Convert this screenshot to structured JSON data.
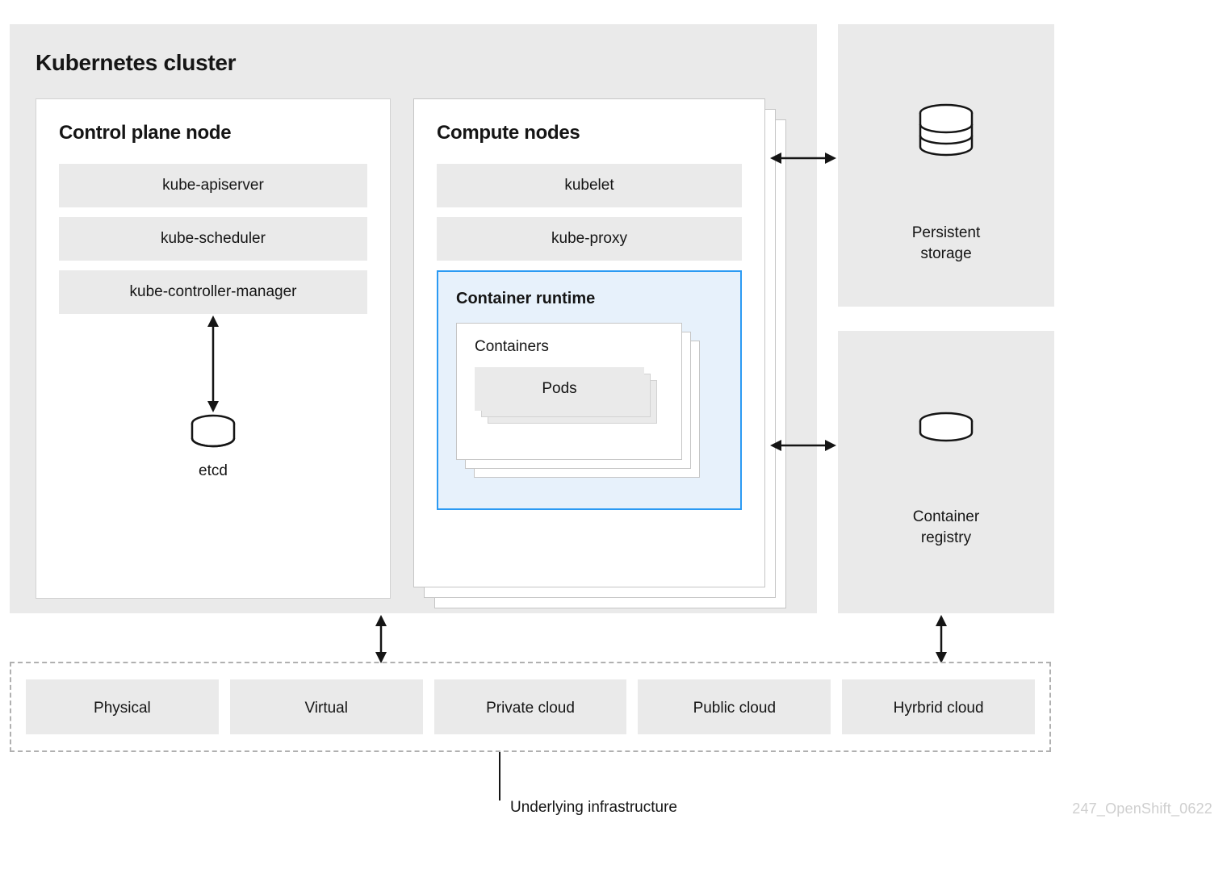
{
  "cluster": {
    "title": "Kubernetes cluster",
    "control_plane": {
      "title": "Control plane node",
      "items": [
        "kube-apiserver",
        "kube-scheduler",
        "kube-controller-manager"
      ],
      "store": "etcd"
    },
    "compute": {
      "title": "Compute nodes",
      "items": [
        "kubelet",
        "kube-proxy"
      ],
      "runtime": {
        "title": "Container runtime",
        "containers_title": "Containers",
        "pods_label": "Pods"
      }
    }
  },
  "side": {
    "storage": "Persistent\nstorage",
    "registry": "Container\nregistry"
  },
  "infra": {
    "items": [
      "Physical",
      "Virtual",
      "Private cloud",
      "Public cloud",
      "Hyrbrid cloud"
    ],
    "caption": "Underlying infrastructure"
  },
  "watermark": "247_OpenShift_0622"
}
